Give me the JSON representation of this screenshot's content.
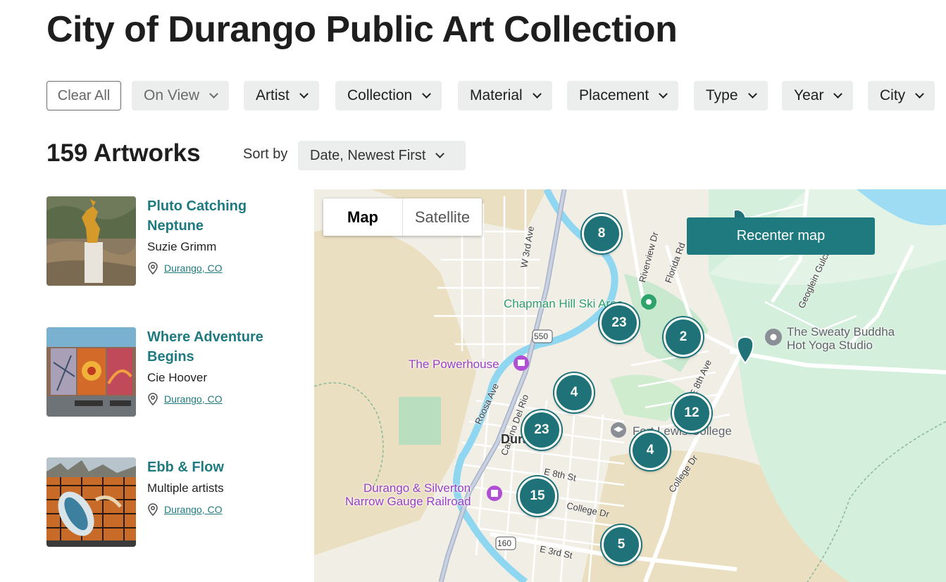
{
  "page": {
    "title": "City of Durango Public Art Collection"
  },
  "filters": {
    "clear_label": "Clear All",
    "items": [
      "On View",
      "Artist",
      "Collection",
      "Material",
      "Placement",
      "Type",
      "Year",
      "City"
    ]
  },
  "results": {
    "count_label": "159 Artworks",
    "sort_label": "Sort by",
    "sort_value": "Date, Newest First"
  },
  "artworks": [
    {
      "title": "Pluto Catching Neptune",
      "artist": "Suzie Grimm",
      "location": "Durango, CO"
    },
    {
      "title": "Where Adventure Begins",
      "artist": "Cie Hoover",
      "location": "Durango, CO"
    },
    {
      "title": "Ebb & Flow",
      "artist": "Multiple artists",
      "location": "Durango, CO"
    }
  ],
  "map": {
    "toggle": {
      "map_label": "Map",
      "satellite_label": "Satellite"
    },
    "recenter_label": "Recenter map",
    "clusters": [
      "8",
      "23",
      "2",
      "4",
      "23",
      "12",
      "4",
      "15",
      "5"
    ],
    "places": {
      "chapman": "Chapman Hill Ski Area",
      "powerhouse": "The Powerhouse",
      "sweaty_1": "The Sweaty Buddha",
      "sweaty_2": "Hot Yoga Studio",
      "fort_lewis": "Fort Lewis College",
      "railroad_1": "Durango & Silverton",
      "railroad_2": "Narrow Gauge Railroad",
      "city": "Durango"
    },
    "roads": {
      "w3rd": "W 3rd Ave",
      "riverview": "Riverview Dr",
      "florida": "Florida Rd",
      "geoglein": "Geoglein Gulch",
      "e8thave": "E 8th Ave",
      "roosa": "Roosa Ave",
      "camino": "Camino Del Rio",
      "college": "College Dr",
      "e8thst": "E 8th St",
      "e3rdst": "E 3rd St",
      "college2": "College Dr",
      "hwy550": "550",
      "hwy160": "160"
    }
  }
}
